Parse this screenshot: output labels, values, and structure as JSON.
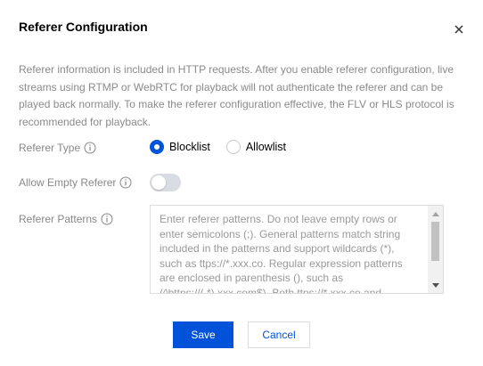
{
  "dialog": {
    "title": "Referer Configuration",
    "close_icon": "close-icon"
  },
  "description": "Referer information is included in HTTP requests. After you enable referer configuration, live streams using RTMP or WebRTC for playback will not authenticate the referer and can be played back normally. To make the referer configuration effective, the FLV or HLS protocol is recommended for playback.",
  "referer_type": {
    "label": "Referer Type",
    "options": [
      {
        "label": "Blocklist",
        "checked": true
      },
      {
        "label": "Allowlist",
        "checked": false
      }
    ]
  },
  "allow_empty": {
    "label": "Allow Empty Referer",
    "enabled": false
  },
  "patterns": {
    "label": "Referer Patterns",
    "placeholder": "Enter referer patterns. Do not leave empty rows or enter semicolons (;). General patterns match string included in the patterns and support  wildcards (*), such as ttps://*.xxx.co. Regular expression patterns are enclosed in parenthesis (), such as (^https://(.*).xxx.com$). Both ttps://*.xxx.co and"
  },
  "buttons": {
    "save": "Save",
    "cancel": "Cancel"
  },
  "colors": {
    "primary": "#0052d9",
    "toggle_off": "#d9dde3",
    "muted_text": "#8a8a8a"
  }
}
